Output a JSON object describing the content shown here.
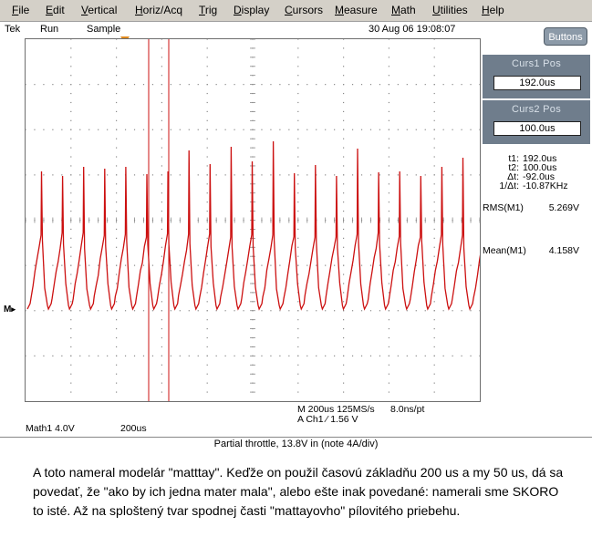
{
  "menu": [
    "File",
    "Edit",
    "Vertical",
    "Horiz/Acq",
    "Trig",
    "Display",
    "Cursors",
    "Measure",
    "Math",
    "Utilities",
    "Help"
  ],
  "status": {
    "brand": "Tek",
    "run": "Run",
    "mode": "Sample",
    "datetime": "30 Aug 06 19:08:07"
  },
  "buttons_label": "Buttons",
  "cursor1": {
    "title": "Curs1 Pos",
    "value": "192.0us"
  },
  "cursor2": {
    "title": "Curs2 Pos",
    "value": "100.0us"
  },
  "cursor_readouts": [
    {
      "label": "t1:",
      "value": "192.0us"
    },
    {
      "label": "t2:",
      "value": "100.0us"
    },
    {
      "label": "Δt:",
      "value": "-92.0us"
    },
    {
      "label": "1/Δt:",
      "value": "-10.87KHz"
    }
  ],
  "measurements": [
    {
      "label": "RMS(M1)",
      "value": "5.269V"
    },
    {
      "label": "Mean(M1)",
      "value": "4.158V"
    }
  ],
  "math_marker": "M",
  "bottom": {
    "timebase": "M 200us 125MS/s",
    "record": "8.0ns/pt",
    "trigger": "A  Ch1  ⁄  1.56    V",
    "math_label": "Math1  4.0V",
    "math_time": "200us"
  },
  "caption": "Partial throttle, 13.8V in (note 4A/div)",
  "paragraph": "A toto nameral modelár \"matttay\". Keďže on použil časovú základňu 200 us a my 50 us, dá sa povedať, že \"ako by ich jedna mater mala\", alebo ešte inak povedané: namerali sme  SKORO  to isté. Až na sploštený tvar spodnej časti \"mattayovho\" pílovitého priebehu.",
  "colors": {
    "trace": "#cc1010",
    "cursor": "#cc1010",
    "grid": "#8a8a8a",
    "trigger_marker": "#e08a1e",
    "panel": "#6f7d8c"
  }
}
